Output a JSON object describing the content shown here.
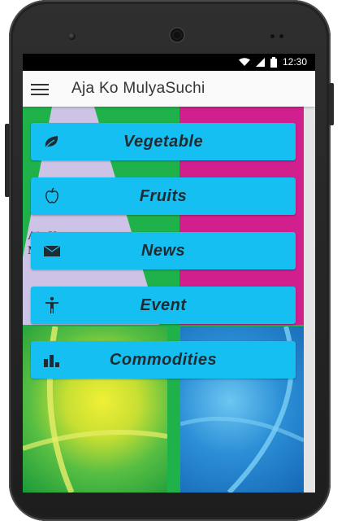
{
  "status_bar": {
    "time": "12:30"
  },
  "app_bar": {
    "title": "Aja Ko MulyaSuchi"
  },
  "background_text": {
    "line1": "Aja K",
    "line2": "M"
  },
  "categories": [
    {
      "label": "Vegetable",
      "icon": "leaf-icon"
    },
    {
      "label": "Fruits",
      "icon": "apple-icon"
    },
    {
      "label": "News",
      "icon": "mail-icon"
    },
    {
      "label": "Event",
      "icon": "person-icon"
    },
    {
      "label": "Commodities",
      "icon": "bar-chart-icon"
    }
  ],
  "colors": {
    "button": "#16bff1",
    "button_text": "#1d2b32",
    "background_green": "#1fb24a",
    "magenta": "#d11f8e"
  }
}
